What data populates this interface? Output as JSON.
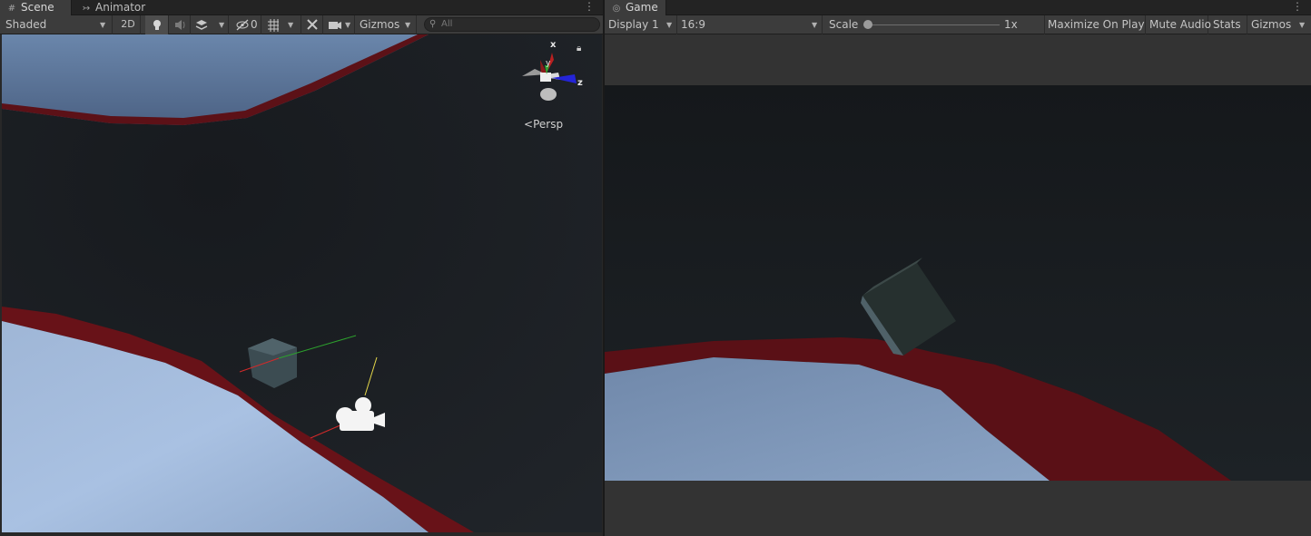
{
  "scene": {
    "tabs": [
      {
        "label": "Scene",
        "icon": "grid-icon",
        "active": true
      },
      {
        "label": "Animator",
        "icon": "animator-icon",
        "active": false
      }
    ],
    "toolbar": {
      "draw_mode": "Shaded",
      "mode_2d": "2D",
      "hidden_count": "0",
      "gizmos": "Gizmos",
      "search_placeholder": "All"
    },
    "gizmo": {
      "axis_x": "x",
      "axis_y": "y",
      "axis_z": "z",
      "projection": "Persp"
    }
  },
  "game": {
    "tab": {
      "label": "Game",
      "icon": "gamepad-icon"
    },
    "toolbar": {
      "display": "Display 1",
      "aspect": "16:9",
      "scale_label": "Scale",
      "scale_value": "1x",
      "maximize": "Maximize On Play",
      "mute": "Mute Audio",
      "stats": "Stats",
      "gizmos": "Gizmos"
    }
  },
  "colors": {
    "sky": "#6f8bb0",
    "sky_light": "#a6bee0",
    "wall": "#12151a",
    "rim": "#6b141a",
    "cube": "#3a4a4f"
  }
}
